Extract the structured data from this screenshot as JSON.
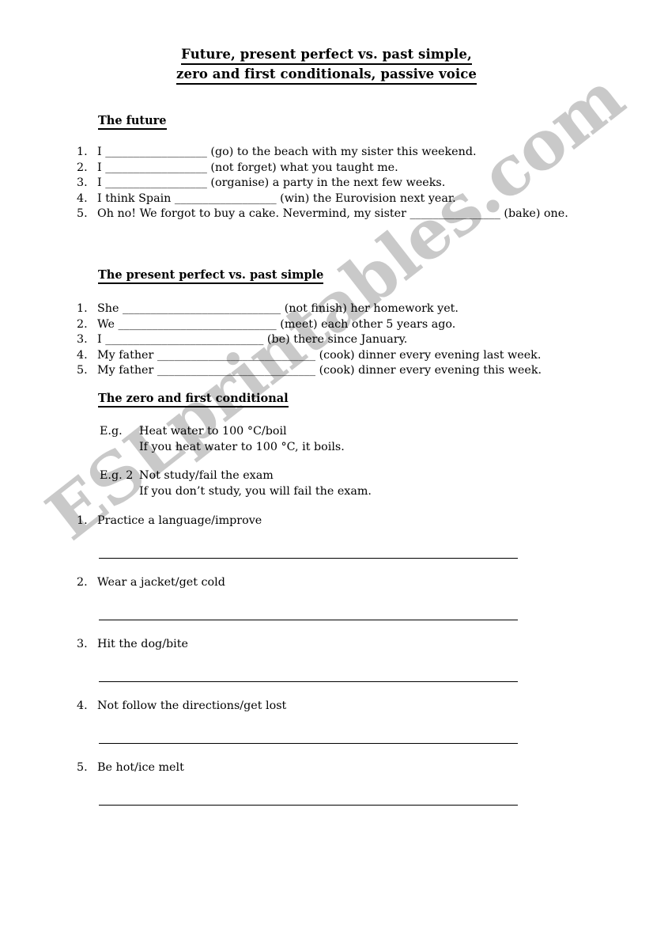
{
  "document": {
    "title_lines": [
      "Future, present perfect vs. past simple,",
      "zero and first conditionals, passive voice"
    ]
  },
  "watermark": {
    "text": "ESLprintables.com",
    "color": "#c9c9c9"
  },
  "sections": {
    "future": {
      "heading": "The future",
      "items": [
        {
          "num": "1.",
          "text": "I __________________ (go) to the beach with my sister this weekend."
        },
        {
          "num": "2.",
          "text": "I __________________ (not forget) what you taught me."
        },
        {
          "num": "3.",
          "text": "I __________________ (organise) a party in the next few weeks."
        },
        {
          "num": "4.",
          "text": "I think Spain __________________ (win) the Eurovision next year."
        },
        {
          "num": "5.",
          "text": "Oh no! We forgot to buy a cake. Nevermind, my sister ________________ (bake) one."
        }
      ]
    },
    "present_perfect": {
      "heading": "The present perfect vs. past simple",
      "items": [
        {
          "num": "1.",
          "text": "She ____________________________ (not finish) her homework yet."
        },
        {
          "num": "2.",
          "text": "We ____________________________ (meet) each other 5 years ago."
        },
        {
          "num": "3.",
          "text": "I ____________________________ (be) there since January."
        },
        {
          "num": "4.",
          "text": "My father ____________________________ (cook) dinner every evening last week."
        },
        {
          "num": "5.",
          "text": "My father ____________________________ (cook) dinner every evening this week."
        }
      ]
    },
    "conditionals": {
      "heading": "The zero and first conditional",
      "examples": [
        {
          "label": "E.g.",
          "line1": "Heat water to 100 °C/boil",
          "line2": "If you heat water to 100 °C, it boils."
        },
        {
          "label": "E.g. 2",
          "line1": "Not study/fail the exam",
          "line2": "If you don’t study, you will fail the exam."
        }
      ],
      "practice_items": [
        {
          "num": "1.",
          "text": "Practice a language/improve"
        },
        {
          "num": "2.",
          "text": "Wear a jacket/get cold"
        },
        {
          "num": "3.",
          "text": "Hit the dog/bite"
        },
        {
          "num": "4.",
          "text": "Not follow the directions/get lost"
        },
        {
          "num": "5.",
          "text": "Be hot/ice melt"
        }
      ]
    }
  }
}
